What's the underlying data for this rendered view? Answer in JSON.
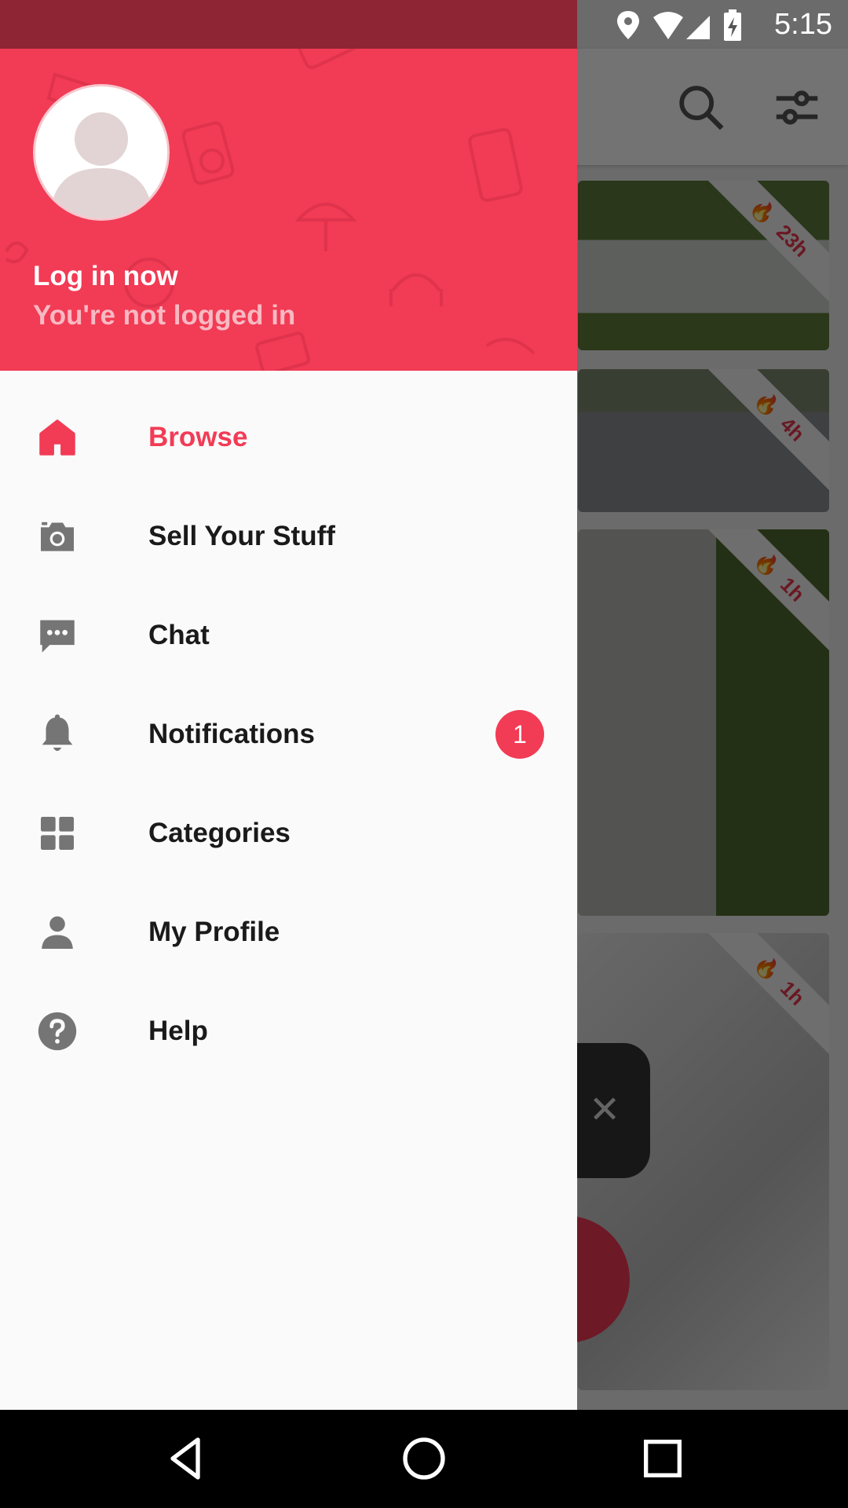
{
  "status_bar": {
    "time": "5:15",
    "icons": [
      "location-icon",
      "wifi-icon",
      "cell-signal-icon",
      "battery-charging-icon"
    ]
  },
  "drawer": {
    "header": {
      "title": "Log in now",
      "subtitle": "You're not logged in"
    },
    "items": [
      {
        "label": "Browse",
        "icon": "home-icon",
        "active": true
      },
      {
        "label": "Sell Your Stuff",
        "icon": "camera-icon"
      },
      {
        "label": "Chat",
        "icon": "chat-icon"
      },
      {
        "label": "Notifications",
        "icon": "bell-icon",
        "badge": "1"
      },
      {
        "label": "Categories",
        "icon": "grid-icon"
      },
      {
        "label": "My Profile",
        "icon": "person-icon"
      },
      {
        "label": "Help",
        "icon": "help-icon"
      }
    ]
  },
  "background": {
    "toolbar_icons": [
      "search-icon",
      "filter-icon"
    ],
    "cards": [
      {
        "age": "23h"
      },
      {
        "age": "4h"
      },
      {
        "age": "1h"
      },
      {
        "age": "1h"
      }
    ]
  },
  "colors": {
    "accent": "#f23b55",
    "status_bar_dark": "#8e2535",
    "drawer_bg": "#fafafa",
    "icon_gray": "#757575"
  }
}
